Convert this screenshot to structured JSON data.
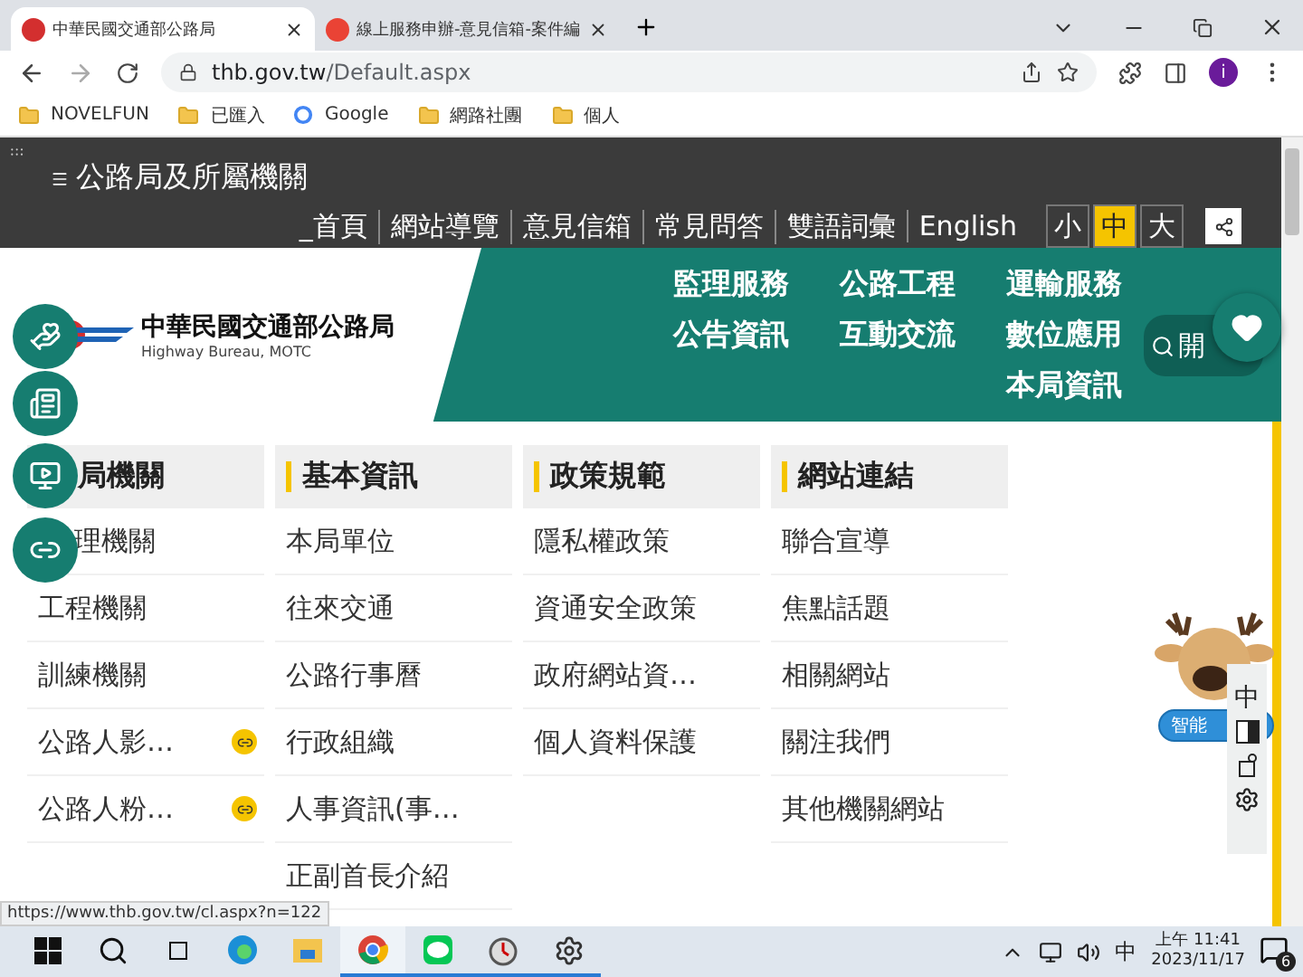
{
  "browser": {
    "tabs": [
      {
        "title": "中華民國交通部公路局",
        "selected": true
      },
      {
        "title": "線上服務申辦-意見信箱-案件編",
        "selected": false
      }
    ],
    "url_host": "thb.gov.tw",
    "url_path": "/Default.aspx",
    "profile": "i",
    "bookmarks": [
      {
        "kind": "folder",
        "label": "NOVELFUN"
      },
      {
        "kind": "folder",
        "label": "已匯入"
      },
      {
        "kind": "google",
        "label": "Google"
      },
      {
        "kind": "folder",
        "label": "網路社團"
      },
      {
        "kind": "folder",
        "label": "個人"
      }
    ]
  },
  "site": {
    "org_menu": "公路局及所屬機關",
    "top_links": [
      "_首頁",
      "網站導覽",
      "意見信箱",
      "常見問答",
      "雙語詞彙",
      "English"
    ],
    "font_sizes": [
      {
        "label": "小",
        "selected": false
      },
      {
        "label": "中",
        "selected": true
      },
      {
        "label": "大",
        "selected": false
      }
    ],
    "logo_title": "中華民國交通部公路局",
    "logo_subtitle": "Highway Bureau, MOTC",
    "nav_rows": [
      [
        "監理服務",
        "公路工程",
        "運輸服務"
      ],
      [
        "公告資訊",
        "互動交流",
        "數位應用"
      ],
      [
        "本局資訊"
      ]
    ],
    "search_label": "開",
    "columns": [
      {
        "heading": "局機關",
        "items": [
          {
            "label": "理機關",
            "external": false
          },
          {
            "label": "工程機關",
            "external": false
          },
          {
            "label": "訓練機關",
            "external": false
          },
          {
            "label": "公路人影…",
            "external": true
          },
          {
            "label": "公路人粉…",
            "external": true
          }
        ]
      },
      {
        "heading": "基本資訊",
        "items": [
          {
            "label": "本局單位",
            "external": false
          },
          {
            "label": "往來交通",
            "external": false
          },
          {
            "label": "公路行事曆",
            "external": false
          },
          {
            "label": "行政組織",
            "external": false
          },
          {
            "label": "人事資訊(事…",
            "external": false
          },
          {
            "label": "正副首長介紹",
            "external": false
          }
        ]
      },
      {
        "heading": "政策規範",
        "items": [
          {
            "label": "隱私權政策",
            "external": false
          },
          {
            "label": "資通安全政策",
            "external": false
          },
          {
            "label": "政府網站資…",
            "external": false
          },
          {
            "label": "個人資料保護",
            "external": false
          }
        ]
      },
      {
        "heading": "網站連結",
        "items": [
          {
            "label": "聯合宣導",
            "external": false
          },
          {
            "label": "焦點話題",
            "external": false
          },
          {
            "label": "相關網站",
            "external": false
          },
          {
            "label": "關注我們",
            "external": false
          },
          {
            "label": "其他機關網站",
            "external": false
          }
        ]
      }
    ],
    "chatbot_label": "智能",
    "a11y_language": "中"
  },
  "status_url": "https://www.thb.gov.tw/cl.aspx?n=122",
  "taskbar": {
    "apps": [
      {
        "kind": "edge",
        "running": false
      },
      {
        "kind": "folder",
        "running": false
      },
      {
        "kind": "chrome",
        "running": true
      },
      {
        "kind": "line",
        "running": true
      },
      {
        "kind": "clock",
        "running": true
      },
      {
        "kind": "settings",
        "running": true
      }
    ],
    "ime": "中",
    "time": "上午 11:41",
    "date": "2023/11/17",
    "notifications": "6"
  }
}
